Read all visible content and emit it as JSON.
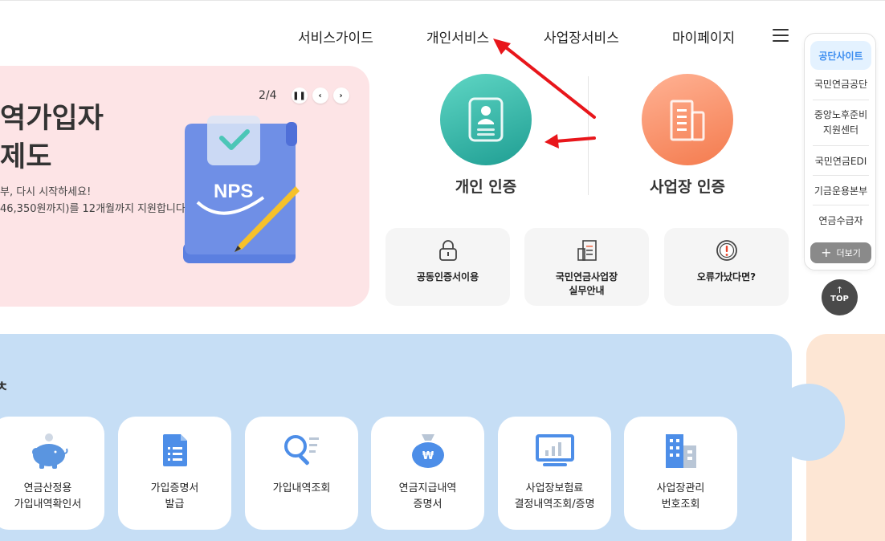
{
  "nav": {
    "items": [
      "서비스가이드",
      "개인서비스",
      "사업장서비스",
      "마이페이지"
    ]
  },
  "banner": {
    "title_line1": "역가입자",
    "title_line2": "제도",
    "sub_line1": "부, 다시 시작하세요!",
    "sub_line2": "46,350원까지)를 12개월까지 지원합니다.",
    "pager": "2/4",
    "logo_text": "NPS"
  },
  "auth": {
    "personal_label": "개인 인증",
    "business_label": "사업장 인증"
  },
  "cards": [
    {
      "label": "공동인증서이용",
      "icon": "lock-icon"
    },
    {
      "label_line1": "국민연금사업장",
      "label_line2": "실무안내",
      "icon": "document-icon"
    },
    {
      "label": "오류가났다면?",
      "icon": "warning-icon"
    }
  ],
  "sidebar": {
    "header": "공단사이트",
    "items": [
      {
        "line1": "국민연금공단"
      },
      {
        "line1": "중앙노후준비",
        "line2": "지원센터"
      },
      {
        "line1": "국민연금EDI"
      },
      {
        "line1": "기금운용본부"
      },
      {
        "line1": "연금수급자"
      }
    ],
    "more": "더보기",
    "top": "TOP"
  },
  "section": {
    "heading_fragment": "ㅊ"
  },
  "tiles": [
    {
      "line1": "연금산정용",
      "line2": "가입내역확인서",
      "icon": "piggy-bank-icon"
    },
    {
      "line1": "가입증명서",
      "line2": "발급",
      "icon": "document-icon"
    },
    {
      "line1": "가입내역조회",
      "line2": "",
      "icon": "search-list-icon"
    },
    {
      "line1": "연금지급내역",
      "line2": "증명서",
      "icon": "money-bag-icon"
    },
    {
      "line1": "사업장보험료",
      "line2": "결정내역조회/증명",
      "icon": "monitor-chart-icon"
    },
    {
      "line1": "사업장관리",
      "line2": "번호조회",
      "icon": "building-icon"
    }
  ],
  "colors": {
    "banner_bg": "#fde4e6",
    "section_bg": "#c6def5",
    "accent_blue": "#3d8ef0",
    "arrow_red": "#e8161b"
  }
}
